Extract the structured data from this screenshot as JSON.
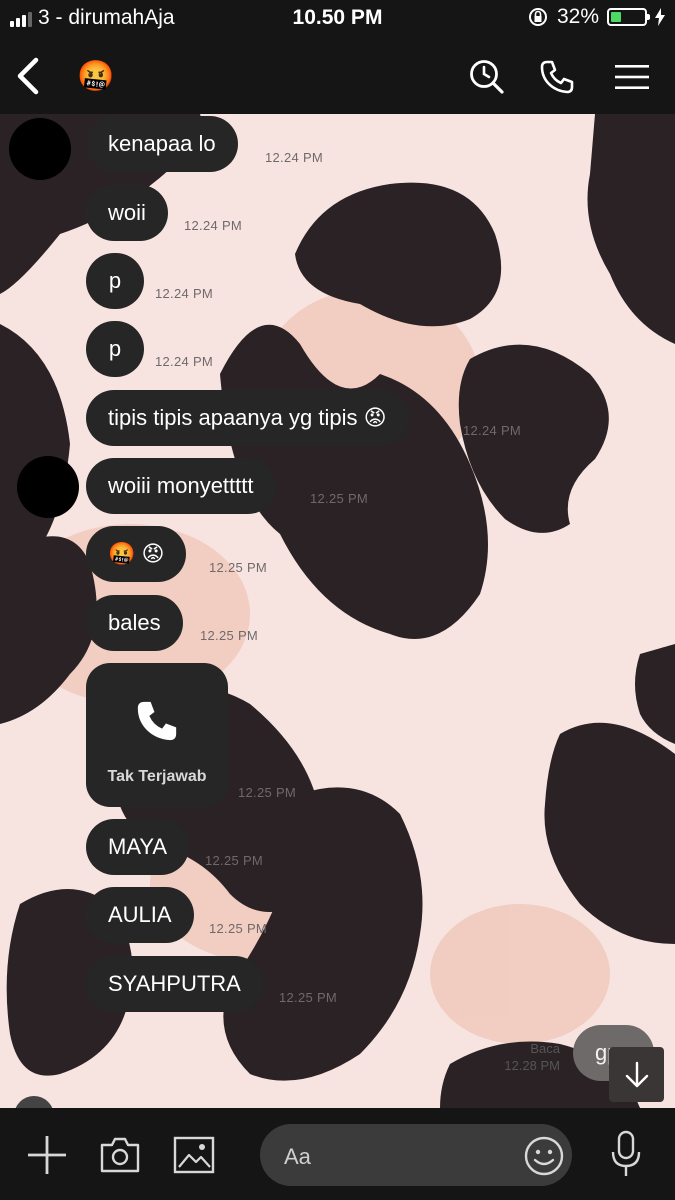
{
  "status_bar": {
    "carrier": "3 - dirumahAja",
    "time": "10.50 PM",
    "battery": "32%",
    "battery_level": 0.32
  },
  "header": {
    "contact_emoji": "🤬",
    "icons": [
      "back-icon",
      "search-history-icon",
      "phone-icon",
      "menu-icon"
    ]
  },
  "messages": [
    {
      "text": "kenapaa lo",
      "time": "12.24 PM"
    },
    {
      "text": "woii",
      "time": "12.24 PM"
    },
    {
      "text": "p",
      "time": "12.24 PM"
    },
    {
      "text": "p",
      "time": "12.24 PM"
    },
    {
      "text": "tipis tipis apaanya yg tipis 😡",
      "time": "12.24 PM"
    },
    {
      "text": "woiii monyettttt",
      "time": "12.25 PM"
    },
    {
      "text": "🤬 😡",
      "time": "12.25 PM"
    },
    {
      "text": "bales",
      "time": "12.25 PM"
    },
    {
      "call_label": "Tak Terjawab",
      "time": "12.25 PM"
    },
    {
      "text": "MAYA",
      "time": "12.25 PM"
    },
    {
      "text": "AULIA",
      "time": "12.25 PM"
    },
    {
      "text": "SYAHPUTRA",
      "time": "12.25 PM"
    }
  ],
  "my_message": {
    "text": "gpp",
    "read_label": "Baca",
    "time": "12.28 PM"
  },
  "input": {
    "placeholder": "Aa"
  },
  "bottom_icons": [
    "plus-icon",
    "camera-icon",
    "image-icon",
    "emoji-icon",
    "microphone-icon"
  ],
  "colors": {
    "bubble": "#262626",
    "background": "#f7e4e1",
    "spots": "#2a2224",
    "bars": "#151515"
  }
}
